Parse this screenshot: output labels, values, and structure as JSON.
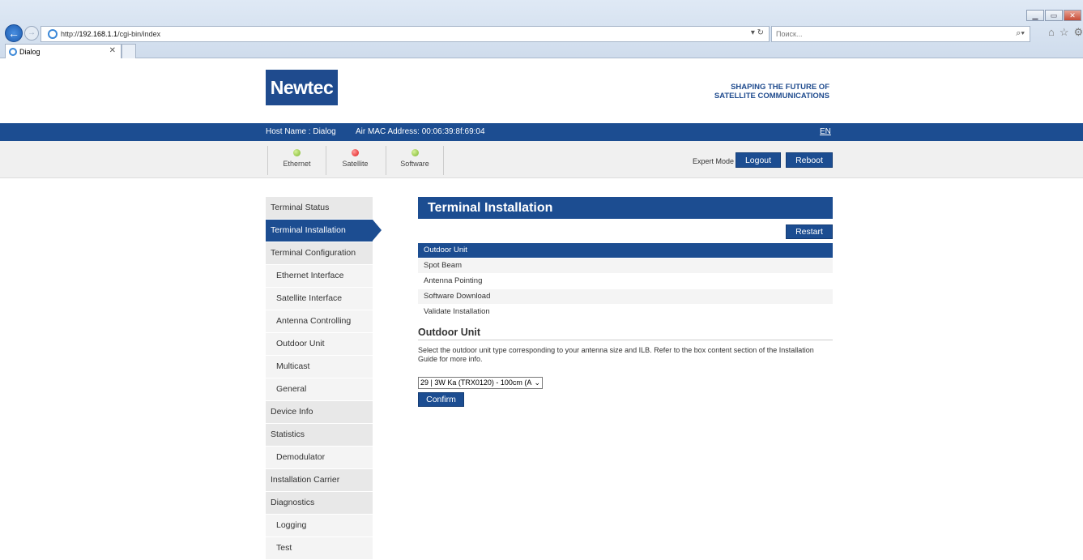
{
  "browser": {
    "url_prefix": "http://",
    "url_host": "192.168.1.1",
    "url_path": "/cgi-bin/index",
    "search_placeholder": "Поиск...",
    "tab_title": "Dialog"
  },
  "header": {
    "logo": "Newtec",
    "tagline_line1": "SHAPING THE FUTURE OF",
    "tagline_line2": "SATELLITE COMMUNICATIONS"
  },
  "hostbar": {
    "host": "Host Name : Dialog",
    "mac": "Air MAC Address:  00:06:39:8f:69:04",
    "lang": "EN"
  },
  "status": {
    "indicators": [
      {
        "label": "Ethernet",
        "color": "#7cb62c"
      },
      {
        "label": "Satellite",
        "color": "#e01818"
      },
      {
        "label": "Software",
        "color": "#7cb62c"
      }
    ],
    "expert_mode": "Expert Mode",
    "logout": "Logout",
    "reboot": "Reboot"
  },
  "sidebar": {
    "items": [
      {
        "label": "Terminal Status"
      },
      {
        "label": "Terminal Installation"
      },
      {
        "label": "Terminal Configuration"
      },
      {
        "label": "Ethernet Interface"
      },
      {
        "label": "Satellite Interface"
      },
      {
        "label": "Antenna Controlling"
      },
      {
        "label": "Outdoor Unit"
      },
      {
        "label": "Multicast"
      },
      {
        "label": "General"
      },
      {
        "label": "Device Info"
      },
      {
        "label": "Statistics"
      },
      {
        "label": "Demodulator"
      },
      {
        "label": "Installation Carrier"
      },
      {
        "label": "Diagnostics"
      },
      {
        "label": "Logging"
      },
      {
        "label": "Test"
      }
    ]
  },
  "main": {
    "title": "Terminal Installation",
    "restart": "Restart",
    "steps": [
      {
        "label": "Outdoor Unit"
      },
      {
        "label": "Spot Beam"
      },
      {
        "label": "Antenna Pointing"
      },
      {
        "label": "Software Download"
      },
      {
        "label": "Validate Installation"
      }
    ],
    "section_title": "Outdoor Unit",
    "description": "Select the outdoor unit type corresponding to your antenna size and ILB. Refer to the box content section of the Installation Guide for more info.",
    "select_value": "29 | 3W Ka (TRX0120) - 100cm (A",
    "confirm": "Confirm"
  }
}
